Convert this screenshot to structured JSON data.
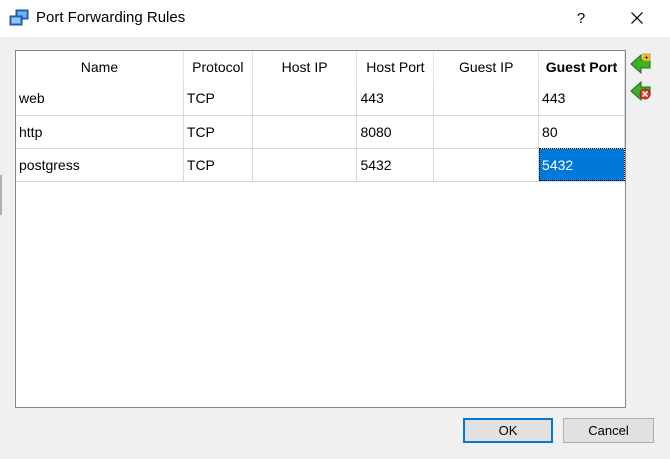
{
  "window": {
    "title": "Port Forwarding Rules",
    "help_label": "?"
  },
  "table": {
    "columns": [
      "Name",
      "Protocol",
      "Host IP",
      "Host Port",
      "Guest IP",
      "Guest Port"
    ],
    "sorted_column": "Guest Port",
    "rows": [
      [
        "web",
        "TCP",
        "",
        "443",
        "",
        "443"
      ],
      [
        "http",
        "TCP",
        "",
        "8080",
        "",
        "80"
      ],
      [
        "postgress",
        "TCP",
        "",
        "5432",
        "",
        "5432"
      ]
    ]
  },
  "side_buttons": {
    "add_icon": "green-add-arrow-icon",
    "remove_icon": "red-remove-x-icon"
  },
  "footer": {
    "ok_label": "OK",
    "cancel_label": "Cancel"
  },
  "colors": {
    "selection": "#0078d7",
    "default_button_border": "#0078d7"
  }
}
